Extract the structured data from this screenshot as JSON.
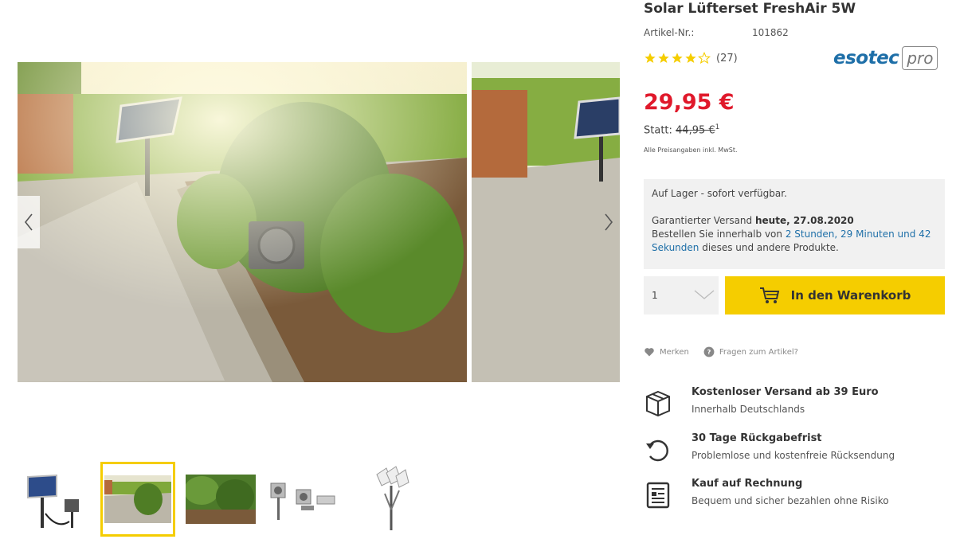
{
  "product": {
    "title": "Solar Lüfterset FreshAir 5W",
    "artnr_label": "Artikel-Nr.:",
    "artnr_value": "101862",
    "rating": 4,
    "rating_max": 5,
    "rating_count": "(27)",
    "brand_name": "esotec",
    "brand_suffix": "pro"
  },
  "pricing": {
    "price": "29,95 €",
    "statt_label": "Statt:",
    "old_price": "44,95 €",
    "footnote": "1",
    "vat_note": "Alle Preisangaben inkl. MwSt."
  },
  "stock": {
    "availability": "Auf Lager - sofort verfügbar.",
    "shipping_prefix": "Garantierter Versand",
    "shipping_date": "heute, 27.08.2020",
    "order_prefix": "Bestellen Sie innerhalb von",
    "countdown": "2 Stunden, 29 Minuten und 42 Sekunden",
    "order_suffix": "dieses und andere Produkte."
  },
  "purchase": {
    "quantity": "1",
    "cart_label": "In den Warenkorb"
  },
  "actions": {
    "remember": "Merken",
    "question": "Fragen zum Artikel?"
  },
  "usps": [
    {
      "title": "Kostenloser Versand ab 39 Euro",
      "subtitle": "Innerhalb Deutschlands",
      "icon": "box-icon"
    },
    {
      "title": "30 Tage Rückgabefrist",
      "subtitle": "Problemlose und kostenfreie Rücksendung",
      "icon": "return-icon"
    },
    {
      "title": "Kauf auf Rechnung",
      "subtitle": "Bequem und sicher bezahlen ohne Risiko",
      "icon": "invoice-icon"
    }
  ],
  "gallery": {
    "active_thumb": 2,
    "thumb_count": 5
  },
  "colors": {
    "accent_yellow": "#f5cd00",
    "price_red": "#e0192b",
    "link_blue": "#1e6fa8"
  }
}
